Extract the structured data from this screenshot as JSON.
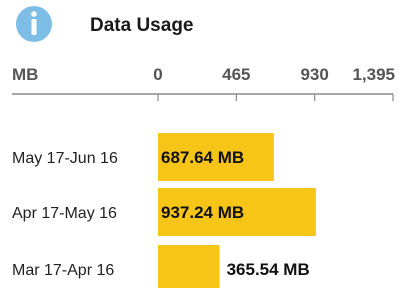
{
  "header": {
    "title": "Data Usage",
    "icon": "info-icon"
  },
  "colors": {
    "bar": "#f7c518",
    "icon": "#7dbde6"
  },
  "chart_data": {
    "type": "bar",
    "orientation": "horizontal",
    "title": "Data Usage",
    "xlabel": "MB",
    "ylabel": "",
    "xlim": [
      0,
      1395
    ],
    "ticks": [
      0,
      465,
      930,
      1395
    ],
    "tick_labels": [
      "0",
      "465",
      "930",
      "1,395"
    ],
    "categories": [
      "May 17-Jun 16",
      "Apr 17-May 16",
      "Mar 17-Apr 16"
    ],
    "values": [
      687.64,
      937.24,
      365.54
    ],
    "value_labels": [
      "687.64 MB",
      "937.24 MB",
      "365.54 MB"
    ]
  }
}
